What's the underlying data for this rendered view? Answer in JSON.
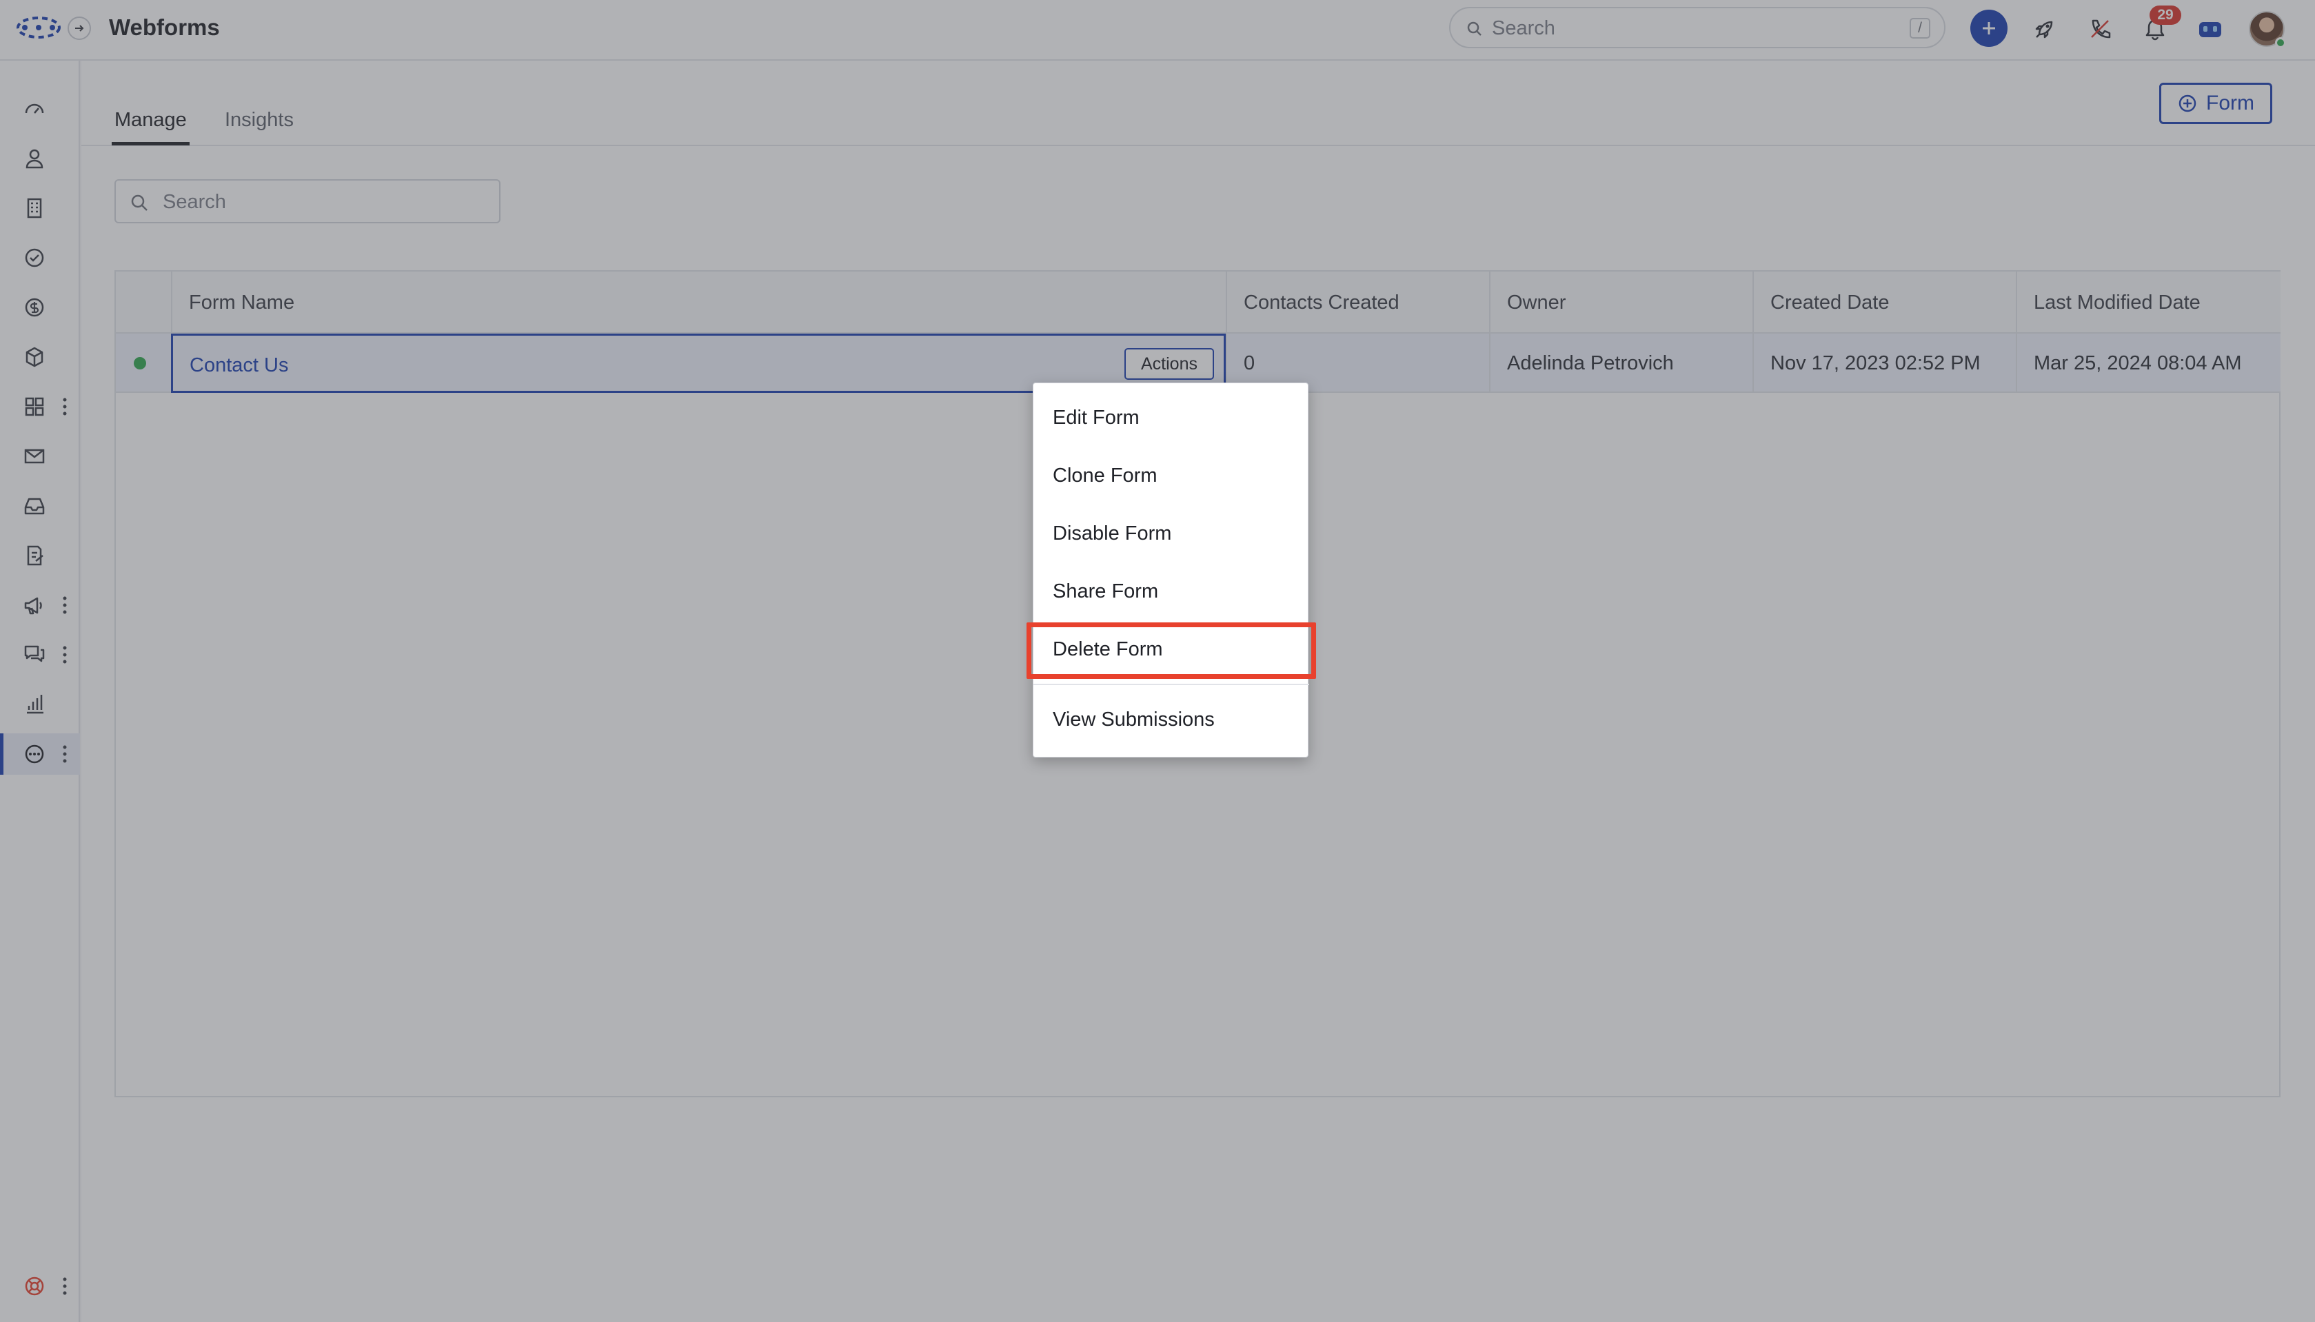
{
  "header": {
    "app_title": "Webforms",
    "search_placeholder": "Search",
    "search_shortcut": "/",
    "notification_count": "29",
    "icons": [
      "app-logo",
      "expand-arrow-icon",
      "search-icon",
      "plus-icon",
      "rocket-icon",
      "phone-icon",
      "bell-icon",
      "bot-icon",
      "user-avatar"
    ]
  },
  "sidebar": {
    "items": [
      {
        "name": "dashboard-icon"
      },
      {
        "name": "contacts-icon"
      },
      {
        "name": "accounts-icon"
      },
      {
        "name": "tasks-icon"
      },
      {
        "name": "deals-icon"
      },
      {
        "name": "products-icon"
      },
      {
        "name": "apps-icon",
        "has_more": true
      },
      {
        "name": "email-icon"
      },
      {
        "name": "inbox-icon"
      },
      {
        "name": "sequences-icon"
      },
      {
        "name": "campaigns-icon",
        "has_more": true
      },
      {
        "name": "conversations-icon",
        "has_more": true
      },
      {
        "name": "analytics-icon"
      },
      {
        "name": "more-icon",
        "has_more": true,
        "active": true
      }
    ],
    "footer_icon": "help-lifebuoy-icon"
  },
  "main": {
    "tabs": [
      {
        "label": "Manage",
        "active": true
      },
      {
        "label": "Insights",
        "active": false
      }
    ],
    "new_button_label": "Form",
    "search_placeholder": "Search",
    "table": {
      "columns": [
        "Form Name",
        "Contacts Created",
        "Owner",
        "Created Date",
        "Last Modified Date"
      ],
      "rows": [
        {
          "status": "active",
          "form_name": "Contact Us",
          "actions_label": "Actions",
          "contacts_created": "0",
          "owner": "Adelinda Petrovich",
          "created_date": "Nov 17, 2023 02:52 PM",
          "last_modified_date": "Mar 25, 2024 08:04 AM"
        }
      ]
    }
  },
  "actions_menu": {
    "items": [
      "Edit Form",
      "Clone Form",
      "Disable Form",
      "Share Form",
      "Delete Form",
      "View Submissions"
    ],
    "highlighted_item": "Delete Form"
  },
  "colors": {
    "accent": "#1a3fb0",
    "highlight": "#e8412d",
    "status_active": "#2fa84f",
    "badge": "#d9342b"
  }
}
